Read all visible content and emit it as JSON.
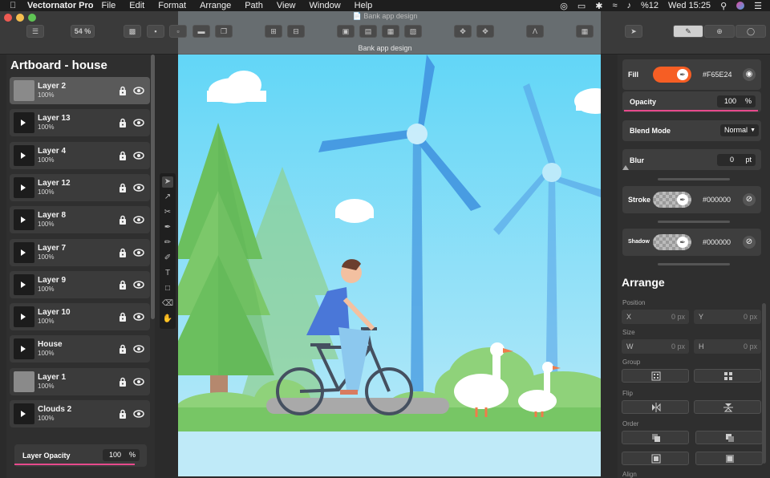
{
  "menubar": {
    "app_name": "Vectornator Pro",
    "items": [
      "File",
      "Edit",
      "Format",
      "Arrange",
      "Path",
      "View",
      "Window",
      "Help"
    ],
    "battery": "%12",
    "clock": "Wed 15:25"
  },
  "toolbar": {
    "document_title": "Bank app design",
    "zoom": "54 %",
    "bottom_title": "Bank app design"
  },
  "layers_panel": {
    "artboard_title": "Artboard - house",
    "layers": [
      {
        "name": "Layer 2",
        "opacity": "100%",
        "selected": true,
        "thumb": "grey"
      },
      {
        "name": "Layer 13",
        "opacity": "100%",
        "selected": false,
        "thumb": "dark"
      },
      {
        "name": "Layer 4",
        "opacity": "100%",
        "selected": false,
        "thumb": "dark"
      },
      {
        "name": "Layer 12",
        "opacity": "100%",
        "selected": false,
        "thumb": "dark"
      },
      {
        "name": "Layer 8",
        "opacity": "100%",
        "selected": false,
        "thumb": "dark"
      },
      {
        "name": "Layer 7",
        "opacity": "100%",
        "selected": false,
        "thumb": "dark"
      },
      {
        "name": "Layer 9",
        "opacity": "100%",
        "selected": false,
        "thumb": "dark"
      },
      {
        "name": "Layer 10",
        "opacity": "100%",
        "selected": false,
        "thumb": "dark"
      },
      {
        "name": "House",
        "opacity": "100%",
        "selected": false,
        "thumb": "dark"
      },
      {
        "name": "Layer 1",
        "opacity": "100%",
        "selected": false,
        "thumb": "grey"
      },
      {
        "name": "Clouds 2",
        "opacity": "100%",
        "selected": false,
        "thumb": "dark"
      }
    ],
    "layer_opacity_label": "Layer Opacity",
    "layer_opacity_value": "100",
    "layer_opacity_unit": "%"
  },
  "style_panel": {
    "fill_label": "Fill",
    "fill_hex": "#F65E24",
    "fill_color": "#F65E24",
    "opacity_label": "Opacity",
    "opacity_value": "100",
    "opacity_unit": "%",
    "blend_label": "Blend Mode",
    "blend_value": "Normal",
    "blur_label": "Blur",
    "blur_value": "0",
    "blur_unit": "pt",
    "stroke_label": "Stroke",
    "stroke_hex": "#000000",
    "shadow_label": "Shadow",
    "shadow_hex": "#000000"
  },
  "arrange_panel": {
    "title": "Arrange",
    "position_label": "Position",
    "x_label": "X",
    "x_value": "0 px",
    "y_label": "Y",
    "y_value": "0 px",
    "size_label": "Size",
    "w_label": "W",
    "w_value": "0 px",
    "h_label": "H",
    "h_value": "0 px",
    "group_label": "Group",
    "flip_label": "Flip",
    "order_label": "Order",
    "align_label": "Align"
  },
  "colors": {
    "accent_pink": "#E74A8C",
    "sky": "#67D6F6",
    "panel_bg": "#2F2F2F"
  }
}
